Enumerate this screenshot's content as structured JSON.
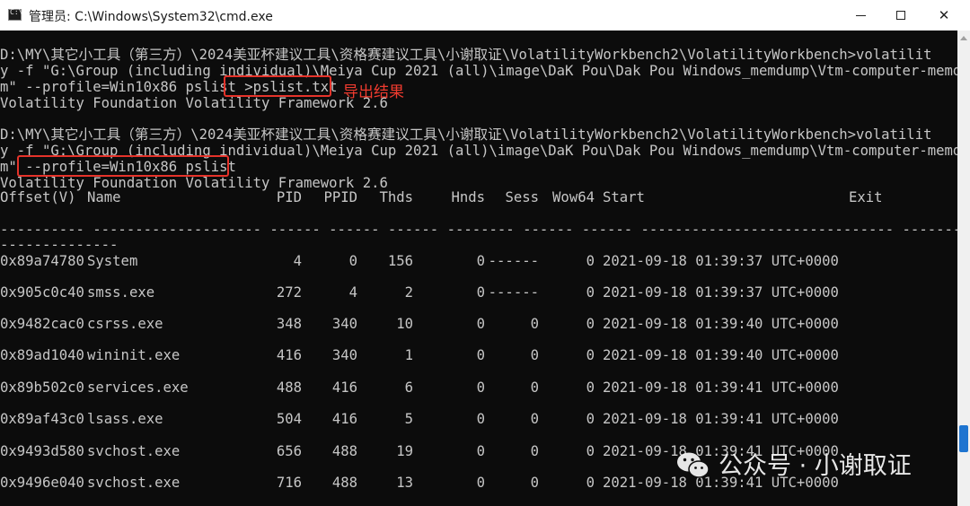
{
  "window": {
    "title": "管理员: C:\\Windows\\System32\\cmd.exe",
    "icon": "cmd-icon",
    "controls": {
      "minimize": "minimize-icon",
      "maximize": "maximize-icon",
      "close": "✕"
    }
  },
  "console": {
    "lines": [
      "D:\\MY\\其它小工具（第三方）\\2024美亚杯建议工具\\资格赛建议工具\\小谢取证\\VolatilityWorkbench2\\VolatilityWorkbench>volatilit",
      "y -f \"G:\\Group (including individual)\\Meiya Cup 2021 (all)\\image\\DaK Pou\\Dak Pou Windows_memdump\\Vtm-computer-memdump.me",
      "m\" --profile=Win10x86 pslist >pslist.txt",
      "Volatility Foundation Volatility Framework 2.6",
      "",
      "D:\\MY\\其它小工具（第三方）\\2024美亚杯建议工具\\资格赛建议工具\\小谢取证\\VolatilityWorkbench2\\VolatilityWorkbench>volatilit",
      "y -f \"G:\\Group (including individual)\\Meiya Cup 2021 (all)\\image\\DaK Pou\\Dak Pou Windows_memdump\\Vtm-computer-memdump.me",
      "m\" --profile=Win10x86 pslist",
      "Volatility Foundation Volatility Framework 2.6"
    ],
    "export_note": "导出结果"
  },
  "table": {
    "headers": {
      "offset": "Offset(V)",
      "name": "Name",
      "pid": "PID",
      "ppid": "PPID",
      "thds": "Thds",
      "hnds": "Hnds",
      "sess": "Sess",
      "wow64": "Wow64",
      "start": "Start",
      "exit": "Exit"
    },
    "separator_line_1": "---------- -------------------- ------ ------ ------ -------- ------ ------ ------------------------------ ----------------",
    "separator_line_2": "--------------",
    "rows": [
      {
        "offset": "0x89a74780",
        "name": "System",
        "pid": "4",
        "ppid": "0",
        "thds": "156",
        "hnds": "0",
        "sess": "------",
        "wow64": "0",
        "start": "2021-09-18 01:39:37 UTC+0000"
      },
      {
        "offset": "0x905c0c40",
        "name": "smss.exe",
        "pid": "272",
        "ppid": "4",
        "thds": "2",
        "hnds": "0",
        "sess": "------",
        "wow64": "0",
        "start": "2021-09-18 01:39:37 UTC+0000"
      },
      {
        "offset": "0x9482cac0",
        "name": "csrss.exe",
        "pid": "348",
        "ppid": "340",
        "thds": "10",
        "hnds": "0",
        "sess": "0",
        "wow64": "0",
        "start": "2021-09-18 01:39:40 UTC+0000"
      },
      {
        "offset": "0x89ad1040",
        "name": "wininit.exe",
        "pid": "416",
        "ppid": "340",
        "thds": "1",
        "hnds": "0",
        "sess": "0",
        "wow64": "0",
        "start": "2021-09-18 01:39:40 UTC+0000"
      },
      {
        "offset": "0x89b502c0",
        "name": "services.exe",
        "pid": "488",
        "ppid": "416",
        "thds": "6",
        "hnds": "0",
        "sess": "0",
        "wow64": "0",
        "start": "2021-09-18 01:39:41 UTC+0000"
      },
      {
        "offset": "0x89af43c0",
        "name": "lsass.exe",
        "pid": "504",
        "ppid": "416",
        "thds": "5",
        "hnds": "0",
        "sess": "0",
        "wow64": "0",
        "start": "2021-09-18 01:39:41 UTC+0000"
      },
      {
        "offset": "0x9493d580",
        "name": "svchost.exe",
        "pid": "656",
        "ppid": "488",
        "thds": "19",
        "hnds": "0",
        "sess": "0",
        "wow64": "0",
        "start": "2021-09-18 01:39:41 UTC+0000"
      },
      {
        "offset": "0x9496e040",
        "name": "svchost.exe",
        "pid": "716",
        "ppid": "488",
        "thds": "13",
        "hnds": "0",
        "sess": "0",
        "wow64": "0",
        "start": "2021-09-18 01:39:41 UTC+0000"
      }
    ]
  },
  "watermark": {
    "icon": "wechat-icon",
    "text": "公众号 · 小谢取证"
  },
  "colors": {
    "console_bg": "#0c0c0c",
    "console_fg": "#c6c6c6",
    "highlight": "#e5332a",
    "note": "#ef3b2f",
    "scroll_thumb": "#1e74d0"
  }
}
